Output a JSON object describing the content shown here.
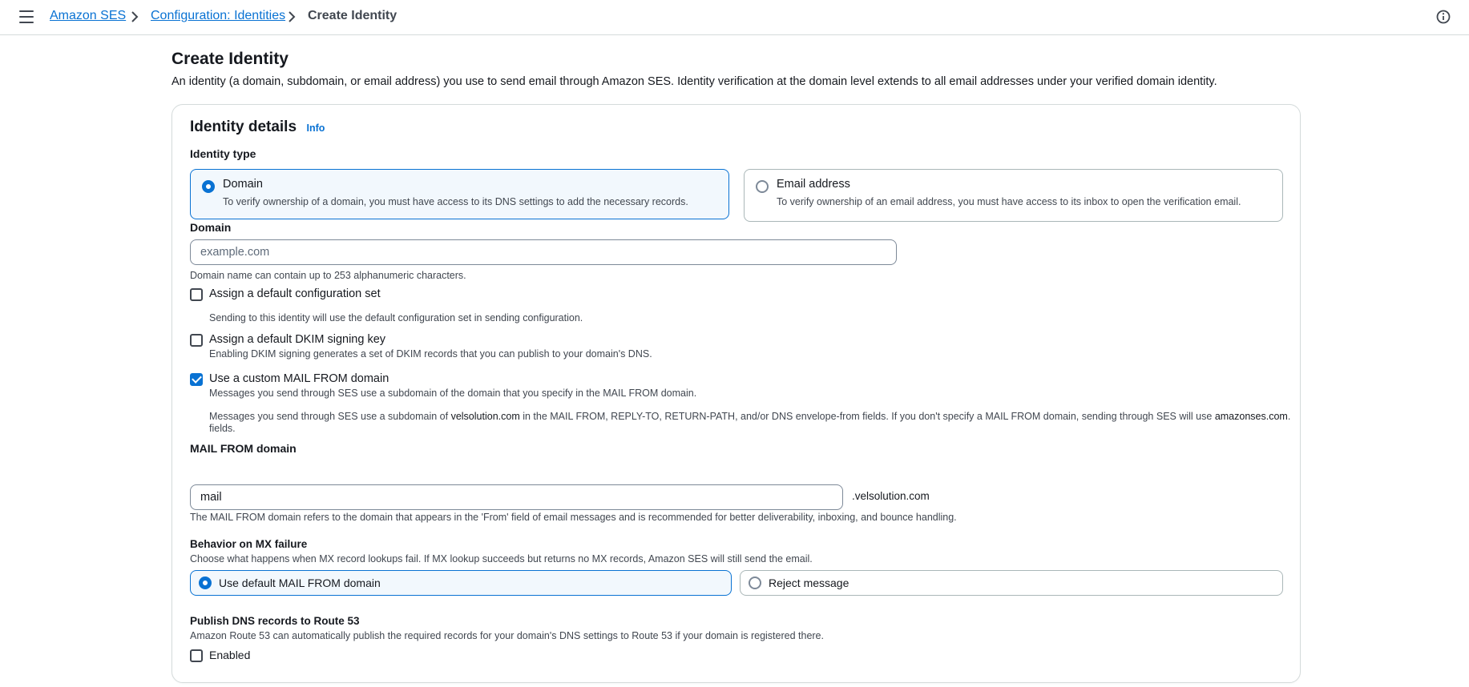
{
  "breadcrumb": {
    "items": [
      "Amazon SES",
      "Configuration: Identities",
      "Create Identity"
    ]
  },
  "header": {
    "title": "Create Identity",
    "description": "An identity (a domain, subdomain, or email address) you use to send email through Amazon SES. Identity verification at the domain level extends to all email addresses under your verified domain identity."
  },
  "identity_details": {
    "title": "Identity details",
    "info_label": "Info",
    "identity_type_label": "Identity type",
    "options": [
      {
        "label": "Domain",
        "description": "To verify ownership of a domain, you must have access to its DNS settings to add the necessary records.",
        "selected": true
      },
      {
        "label": "Email address",
        "description": "To verify ownership of an email address, you must have access to its inbox to open the verification email.",
        "selected": false
      }
    ]
  },
  "domain": {
    "label": "Domain",
    "placeholder": "example.com",
    "value": "",
    "constraint": "Domain name can contain up to 253 alphanumeric characters."
  },
  "checkboxes": {
    "config_set": {
      "label": "Assign a default configuration set",
      "description": "Sending to this identity will use the default configuration set in sending configuration.",
      "checked": false
    },
    "dkim": {
      "label": "Assign a default DKIM signing key",
      "description": "Enabling DKIM signing generates a set of DKIM records that you can publish to your domain's DNS.",
      "checked": false
    },
    "mail_from": {
      "label": "Use a custom MAIL FROM domain",
      "description": "Messages you send through SES use a subdomain of the domain that you specify in the MAIL FROM domain.",
      "checked": true,
      "note_part1": "Messages you send through SES use a subdomain of ",
      "note_domain": "velsolution.com",
      "note_part2": " in the MAIL FROM, REPLY-TO, RETURN-PATH, and/or DNS envelope-from fields. If you don't specify a MAIL FROM domain, sending through SES will use ",
      "note_default": "amazonses.com",
      "note_part3": ".",
      "note_line2": "fields."
    }
  },
  "mail_from_domain": {
    "label": "MAIL FROM domain",
    "value": "mail",
    "suffix": ".velsolution.com",
    "description": "The MAIL FROM domain refers to the domain that appears in the 'From' field of email messages and is recommended for better deliverability, inboxing, and bounce handling."
  },
  "mx_failure": {
    "label": "Behavior on MX failure",
    "description": "Choose what happens when MX record lookups fail. If MX lookup succeeds but returns no MX records, Amazon SES will still send the email.",
    "options": [
      {
        "label": "Use default MAIL FROM domain",
        "selected": true
      },
      {
        "label": "Reject message",
        "selected": false
      }
    ]
  },
  "route53": {
    "label": "Publish DNS records to Route 53",
    "description": "Amazon Route 53 can automatically publish the required records for your domain's DNS settings to Route 53 if your domain is registered there.",
    "checkbox_label": "Enabled",
    "checked": false
  },
  "colors": {
    "link": "#0972d3",
    "border": "#d5dbdb",
    "selected_bg": "#f2f8fd",
    "text": "#16191f",
    "muted": "#414750"
  },
  "icons": {
    "menu": "hamburger-menu-icon",
    "separator": "chevron-right-icon",
    "help": "info-circle-icon"
  }
}
